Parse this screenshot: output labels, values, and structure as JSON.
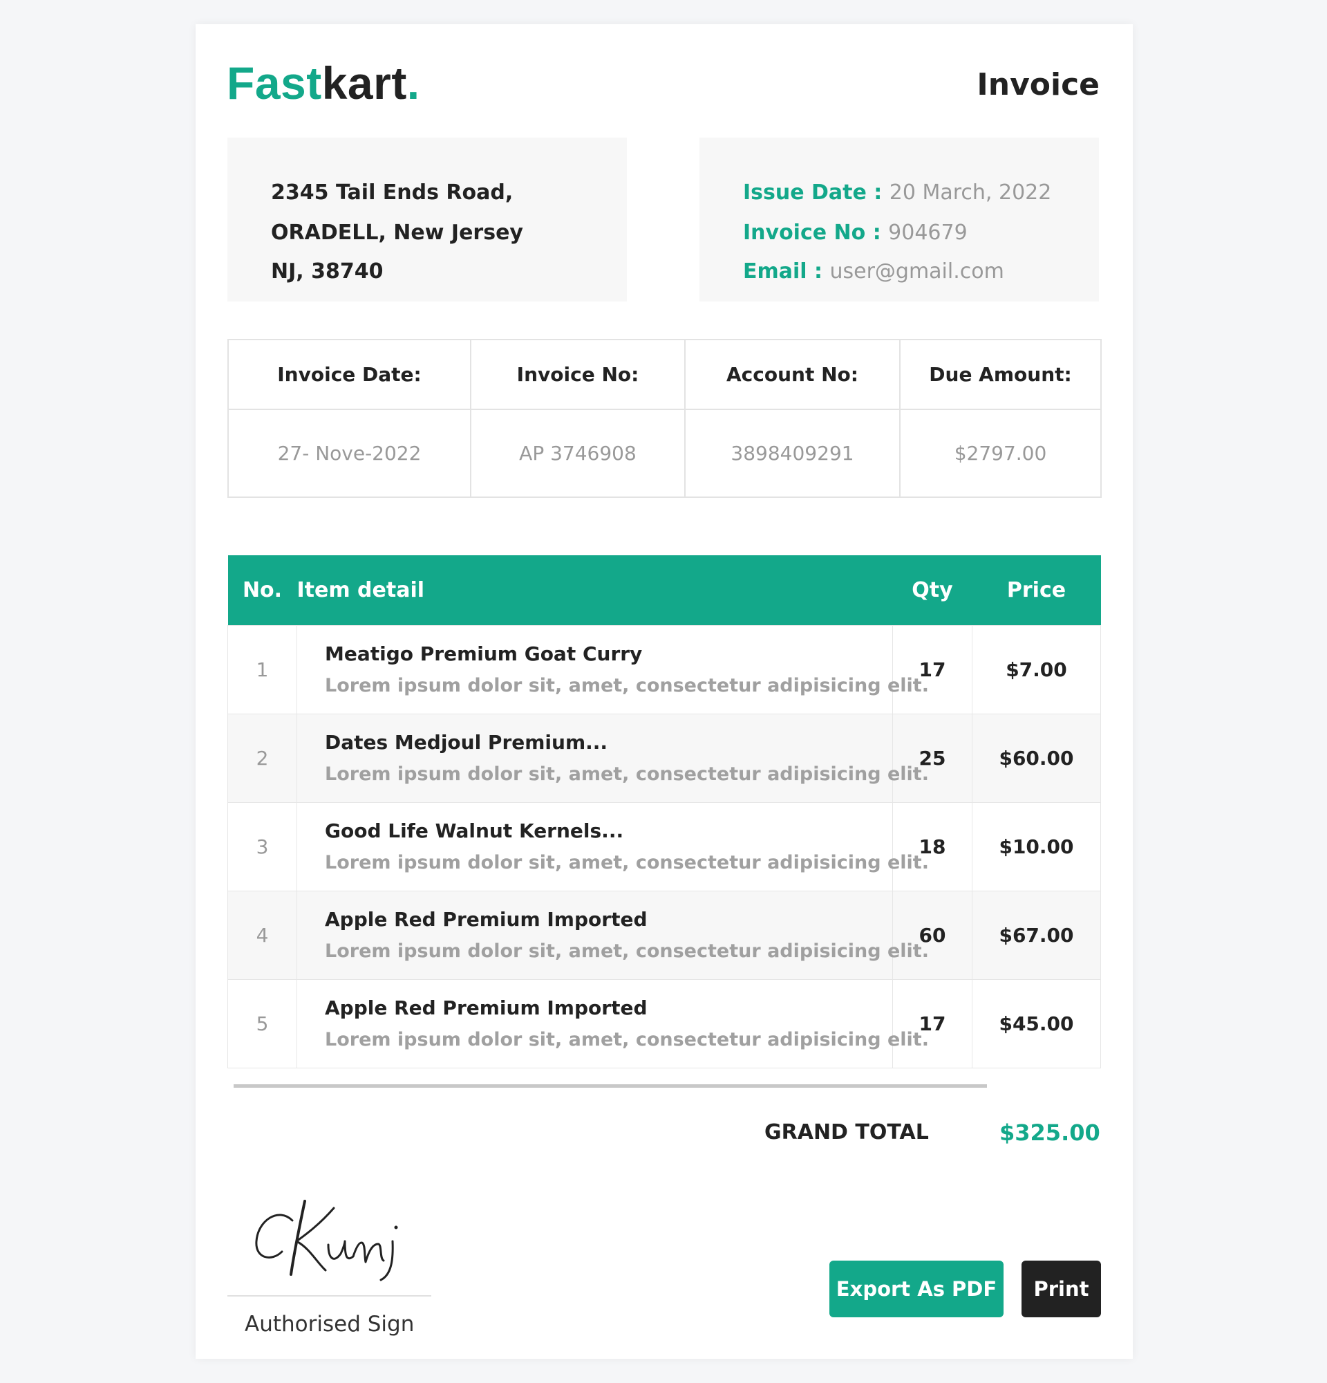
{
  "brand": {
    "part1": "Fast",
    "part2": "kart",
    "dot": "."
  },
  "header": {
    "title": "Invoice"
  },
  "address": {
    "line1": "2345 Tail Ends Road,",
    "line2": "ORADELL, New Jersey",
    "line3": "NJ, 38740"
  },
  "meta": {
    "issue_date_label": "Issue Date :",
    "issue_date": "20 March, 2022",
    "invoice_no_label": "Invoice No :",
    "invoice_no": "904679",
    "email_label": "Email :",
    "email": "user@gmail.com"
  },
  "summary": {
    "headers": [
      "Invoice Date:",
      "Invoice No:",
      "Account No:",
      "Due Amount:"
    ],
    "values": [
      "27- Nove-2022",
      "AP 3746908",
      "3898409291",
      "$2797.00"
    ]
  },
  "items": {
    "headers": {
      "no": "No.",
      "detail": "Item detail",
      "qty": "Qty",
      "price": "Price"
    },
    "rows": [
      {
        "no": "1",
        "name": "Meatigo Premium Goat Curry",
        "desc": "Lorem ipsum dolor sit, amet, consectetur adipisicing elit.",
        "qty": "17",
        "price": "$7.00"
      },
      {
        "no": "2",
        "name": "Dates Medjoul Premium...",
        "desc": "Lorem ipsum dolor sit, amet, consectetur adipisicing elit.",
        "qty": "25",
        "price": "$60.00"
      },
      {
        "no": "3",
        "name": "Good Life Walnut Kernels...",
        "desc": "Lorem ipsum dolor sit, amet, consectetur adipisicing elit.",
        "qty": "18",
        "price": "$10.00"
      },
      {
        "no": "4",
        "name": "Apple Red Premium Imported",
        "desc": "Lorem ipsum dolor sit, amet, consectetur adipisicing elit.",
        "qty": "60",
        "price": "$67.00"
      },
      {
        "no": "5",
        "name": "Apple Red Premium Imported",
        "desc": "Lorem ipsum dolor sit, amet, consectetur adipisicing elit.",
        "qty": "17",
        "price": "$45.00"
      }
    ]
  },
  "totals": {
    "label": "GRAND TOTAL",
    "value": "$325.00"
  },
  "signature": {
    "name": "Kunj",
    "label": "Authorised Sign"
  },
  "actions": {
    "export_label": "Export As PDF",
    "print_label": "Print"
  },
  "colors": {
    "accent": "#13a88a",
    "dark": "#222222",
    "muted": "#999999",
    "panel": "#f7f7f7"
  }
}
